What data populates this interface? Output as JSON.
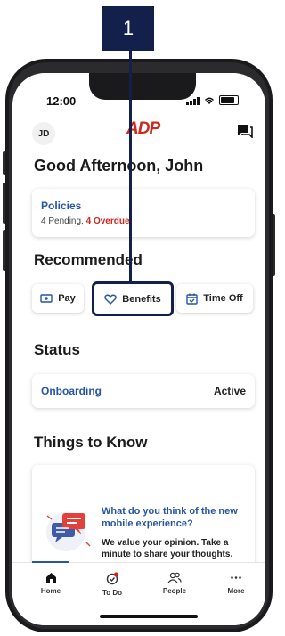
{
  "callout": {
    "number": "1"
  },
  "status_bar": {
    "time": "12:00"
  },
  "header": {
    "avatar_initials": "JD",
    "logo_text": "ADP",
    "icon": "chat-icon"
  },
  "greeting": "Good Afternoon, John",
  "policies": {
    "title": "Policies",
    "pending": "4 Pending,",
    "overdue": "4 Overdue"
  },
  "recommended": {
    "title": "Recommended",
    "buttons": [
      {
        "label": "Pay",
        "icon": "pay-icon"
      },
      {
        "label": "Benefits",
        "icon": "heart-icon"
      },
      {
        "label": "Time Off",
        "icon": "calendar-icon"
      }
    ]
  },
  "status": {
    "title": "Status",
    "item_label": "Onboarding",
    "item_value": "Active"
  },
  "things_to_know": {
    "title": "Things to Know",
    "card_title": "What do you think of the new mobile experience?",
    "card_text": "We value your opinion. Take a minute to share your thoughts."
  },
  "tabs": [
    {
      "label": "Home",
      "icon": "home-icon"
    },
    {
      "label": "To Do",
      "icon": "todo-icon"
    },
    {
      "label": "People",
      "icon": "people-icon"
    },
    {
      "label": "More",
      "icon": "more-icon"
    }
  ],
  "colors": {
    "accent": "#2755a5",
    "brand": "#d0271d",
    "callout": "#13204b"
  }
}
